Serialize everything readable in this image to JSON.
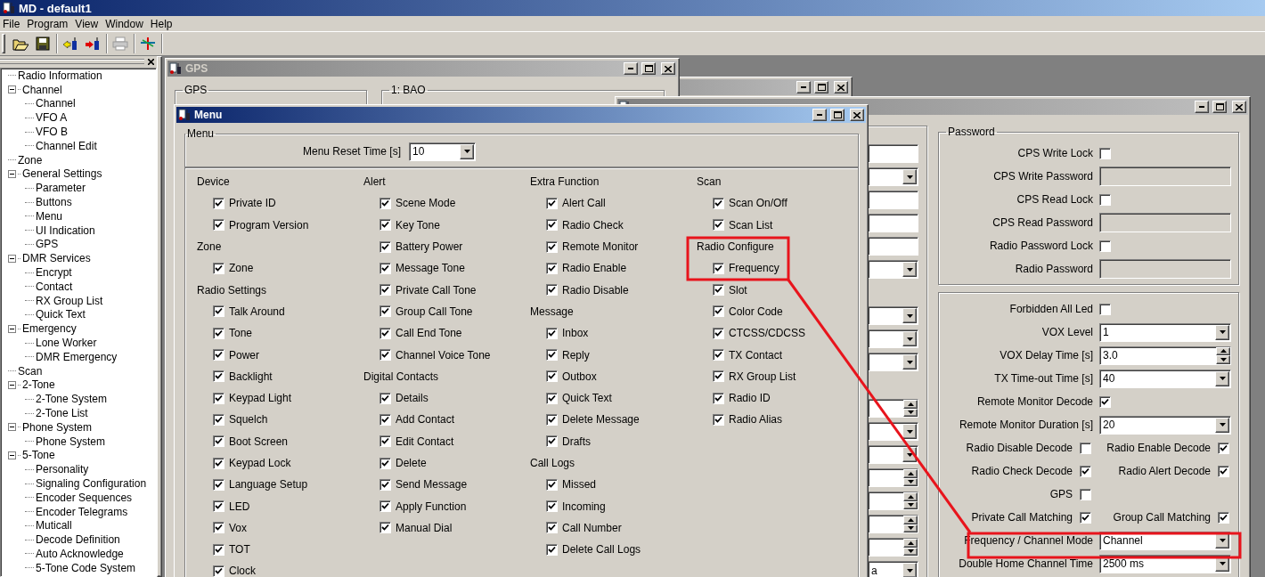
{
  "app_title": "MD - default1",
  "menubar": [
    "File",
    "Program",
    "View",
    "Window",
    "Help"
  ],
  "toolbar": [
    {
      "items": [
        {
          "kind": "open",
          "disabled": false
        },
        {
          "kind": "save",
          "disabled": false
        }
      ]
    },
    {
      "items": [
        {
          "kind": "read",
          "disabled": false
        },
        {
          "kind": "write",
          "disabled": false
        }
      ]
    },
    {
      "items": [
        {
          "kind": "print",
          "disabled": true
        }
      ]
    },
    {
      "items": [
        {
          "kind": "tool",
          "disabled": false
        }
      ]
    }
  ],
  "tree": [
    {
      "label": "Radio Information"
    },
    {
      "label": "Channel",
      "expanded": true,
      "children": [
        {
          "label": "Channel"
        },
        {
          "label": "VFO A"
        },
        {
          "label": "VFO B"
        },
        {
          "label": "Channel Edit"
        }
      ]
    },
    {
      "label": "Zone"
    },
    {
      "label": "General Settings",
      "expanded": true,
      "children": [
        {
          "label": "Parameter"
        },
        {
          "label": "Buttons"
        },
        {
          "label": "Menu"
        },
        {
          "label": "UI Indication"
        },
        {
          "label": "GPS"
        }
      ]
    },
    {
      "label": "DMR Services",
      "expanded": true,
      "children": [
        {
          "label": "Encrypt"
        },
        {
          "label": "Contact"
        },
        {
          "label": "RX Group List"
        },
        {
          "label": "Quick Text"
        }
      ]
    },
    {
      "label": "Emergency",
      "expanded": true,
      "children": [
        {
          "label": "Lone Worker"
        },
        {
          "label": "DMR Emergency"
        }
      ]
    },
    {
      "label": "Scan"
    },
    {
      "label": "2-Tone",
      "expanded": true,
      "children": [
        {
          "label": "2-Tone System"
        },
        {
          "label": "2-Tone List"
        }
      ]
    },
    {
      "label": "Phone System",
      "expanded": true,
      "children": [
        {
          "label": "Phone System"
        }
      ]
    },
    {
      "label": "5-Tone",
      "expanded": true,
      "children": [
        {
          "label": "Personality"
        },
        {
          "label": "Signaling Configuration"
        },
        {
          "label": "Encoder Sequences"
        },
        {
          "label": "Encoder Telegrams"
        },
        {
          "label": "Muticall"
        },
        {
          "label": "Decode Definition"
        },
        {
          "label": "Auto Acknowledge"
        },
        {
          "label": "5-Tone Code System"
        }
      ]
    }
  ],
  "gps_window": {
    "title": "GPS",
    "groups": [
      "GPS",
      "1: BAO"
    ]
  },
  "parameter_window": {
    "left_fields": [
      {
        "kind": "input"
      },
      {
        "kind": "dropdown"
      },
      {
        "kind": "input"
      },
      {
        "kind": "input"
      },
      {
        "kind": "input"
      },
      {
        "kind": "dropdown"
      },
      {
        "kind": "blank"
      },
      {
        "kind": "dropdown"
      },
      {
        "kind": "dropdown"
      },
      {
        "kind": "dropdown"
      },
      {
        "kind": "blank"
      },
      {
        "kind": "spinner"
      },
      {
        "kind": "dropdown"
      },
      {
        "kind": "dropdown"
      },
      {
        "kind": "spinner"
      },
      {
        "kind": "spinner"
      },
      {
        "kind": "spinner"
      },
      {
        "kind": "spinner"
      },
      {
        "kind": "dropdown",
        "value": "a"
      }
    ],
    "password": {
      "title": "Password",
      "rows": [
        {
          "kind": "checkbox",
          "label": "CPS Write Lock",
          "checked": false
        },
        {
          "kind": "password",
          "label": "CPS Write Password"
        },
        {
          "kind": "checkbox",
          "label": "CPS Read Lock",
          "checked": false
        },
        {
          "kind": "password",
          "label": "CPS Read Password"
        },
        {
          "kind": "checkbox",
          "label": "Radio Password Lock",
          "checked": false
        },
        {
          "kind": "password",
          "label": "Radio Password"
        }
      ]
    },
    "settings": {
      "rows": [
        {
          "kind": "checkbox",
          "label": "Forbidden All Led",
          "checked": false
        },
        {
          "kind": "dropdown",
          "label": "VOX Level",
          "value": "1"
        },
        {
          "kind": "spinner",
          "label": "VOX Delay Time [s]",
          "value": "3.0"
        },
        {
          "kind": "dropdown",
          "label": "TX Time-out Time [s]",
          "value": "40"
        },
        {
          "kind": "checkbox",
          "label": "Remote Monitor Decode",
          "checked": true
        },
        {
          "kind": "dropdown",
          "label": "Remote Monitor Duration [s]",
          "value": "20"
        },
        {
          "kind": "pair",
          "items": [
            {
              "label": "Radio Disable Decode",
              "checked": false
            },
            {
              "label": "Radio Enable Decode",
              "checked": true
            }
          ]
        },
        {
          "kind": "pair",
          "items": [
            {
              "label": "Radio Check Decode",
              "checked": true
            },
            {
              "label": "Radio Alert Decode",
              "checked": true
            }
          ]
        },
        {
          "kind": "pair",
          "items": [
            {
              "label": "GPS",
              "checked": false
            }
          ]
        },
        {
          "kind": "pair",
          "items": [
            {
              "label": "Private Call Matching",
              "checked": true
            },
            {
              "label": "Group Call Matching",
              "checked": true
            }
          ]
        },
        {
          "kind": "dropdown",
          "label": "Frequency / Channel Mode",
          "value": "Channel"
        },
        {
          "kind": "dropdown",
          "label": "Double Home Channel Time",
          "value": "2500 ms"
        }
      ]
    }
  },
  "menu_window": {
    "title": "Menu",
    "group": "Menu",
    "reset_label": "Menu Reset Time [s]",
    "reset_value": "10",
    "columns": [
      {
        "groups": [
          {
            "heading": "Device",
            "items": [
              {
                "label": "Private ID",
                "checked": true
              },
              {
                "label": "Program Version",
                "checked": true
              }
            ]
          },
          {
            "heading": "Zone",
            "items": [
              {
                "label": "Zone",
                "checked": true
              }
            ]
          },
          {
            "heading": "Radio Settings",
            "items": [
              {
                "label": "Talk Around",
                "checked": true
              },
              {
                "label": "Tone",
                "checked": true
              },
              {
                "label": "Power",
                "checked": true
              },
              {
                "label": "Backlight",
                "checked": true
              },
              {
                "label": "Keypad Light",
                "checked": true
              },
              {
                "label": "Squelch",
                "checked": true
              },
              {
                "label": "Boot Screen",
                "checked": true
              },
              {
                "label": "Keypad Lock",
                "checked": true
              },
              {
                "label": "Language Setup",
                "checked": true
              },
              {
                "label": "LED",
                "checked": true
              },
              {
                "label": "Vox",
                "checked": true
              },
              {
                "label": "TOT",
                "checked": true
              },
              {
                "label": "Clock",
                "checked": true
              }
            ]
          }
        ]
      },
      {
        "groups": [
          {
            "heading": "Alert",
            "items": [
              {
                "label": "Scene Mode",
                "checked": true
              },
              {
                "label": "Key Tone",
                "checked": true
              },
              {
                "label": "Battery Power",
                "checked": true
              },
              {
                "label": "Message Tone",
                "checked": true
              },
              {
                "label": "Private Call Tone",
                "checked": true
              },
              {
                "label": "Group Call Tone",
                "checked": true
              },
              {
                "label": "Call End Tone",
                "checked": true
              },
              {
                "label": "Channel Voice Tone",
                "checked": true
              }
            ]
          },
          {
            "heading": "Digital Contacts",
            "items": [
              {
                "label": "Details",
                "checked": true
              },
              {
                "label": "Add Contact",
                "checked": true
              },
              {
                "label": "Edit Contact",
                "checked": true
              },
              {
                "label": "Delete",
                "checked": true
              },
              {
                "label": "Send Message",
                "checked": true
              },
              {
                "label": "Apply Function",
                "checked": true
              },
              {
                "label": "Manual Dial",
                "checked": true
              }
            ]
          }
        ]
      },
      {
        "groups": [
          {
            "heading": "Extra Function",
            "items": [
              {
                "label": "Alert Call",
                "checked": true
              },
              {
                "label": "Radio Check",
                "checked": true
              },
              {
                "label": "Remote Monitor",
                "checked": true
              },
              {
                "label": "Radio Enable",
                "checked": true
              },
              {
                "label": "Radio Disable",
                "checked": true
              }
            ]
          },
          {
            "heading": "Message",
            "items": [
              {
                "label": "Inbox",
                "checked": true
              },
              {
                "label": "Reply",
                "checked": true
              },
              {
                "label": "Outbox",
                "checked": true
              },
              {
                "label": "Quick Text",
                "checked": true
              },
              {
                "label": "Delete Message",
                "checked": true
              },
              {
                "label": "Drafts",
                "checked": true
              }
            ]
          },
          {
            "heading": "Call Logs",
            "items": [
              {
                "label": "Missed",
                "checked": true
              },
              {
                "label": "Incoming",
                "checked": true
              },
              {
                "label": "Call Number",
                "checked": true
              },
              {
                "label": "Delete Call Logs",
                "checked": true
              }
            ]
          }
        ]
      },
      {
        "groups": [
          {
            "heading": "Scan",
            "items": [
              {
                "label": "Scan On/Off",
                "checked": true
              },
              {
                "label": "Scan List",
                "checked": true
              }
            ]
          },
          {
            "heading": "Radio Configure",
            "items": [
              {
                "label": "Frequency",
                "checked": true
              },
              {
                "label": "Slot",
                "checked": true
              },
              {
                "label": "Color Code",
                "checked": true
              },
              {
                "label": "CTCSS/CDCSS",
                "checked": true
              },
              {
                "label": "TX Contact",
                "checked": true
              },
              {
                "label": "RX Group List",
                "checked": true
              },
              {
                "label": "Radio ID",
                "checked": true
              },
              {
                "label": "Radio Alias",
                "checked": true
              }
            ]
          }
        ]
      }
    ]
  }
}
